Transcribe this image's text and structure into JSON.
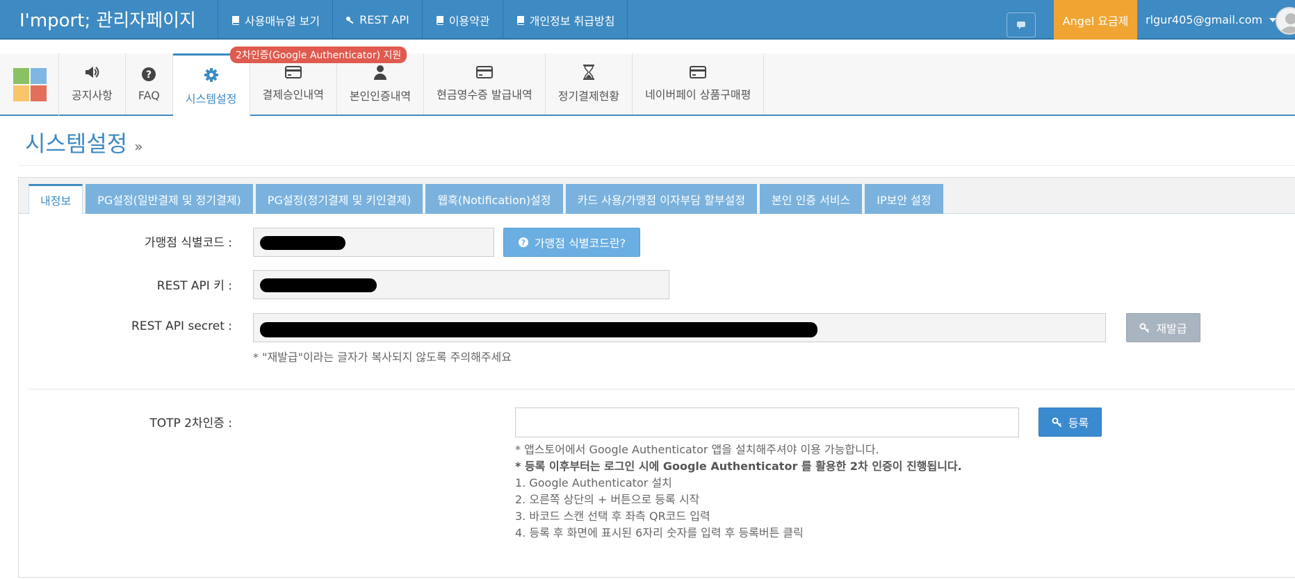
{
  "topbar": {
    "brand": "I'mport; 관리자페이지",
    "nav": [
      {
        "label": "사용매뉴얼 보기",
        "icon": "book-icon"
      },
      {
        "label": "REST API",
        "icon": "key-icon"
      },
      {
        "label": "이용약관",
        "icon": "book-icon"
      },
      {
        "label": "개인정보 취급방침",
        "icon": "book-icon"
      }
    ],
    "plan_label": "Angel 요금제",
    "user_email": "rlgur405@gmail.com"
  },
  "menu": {
    "promo_badge": "2차인증(Google Authenticator) 지원",
    "tabs": [
      {
        "label": "공지사항",
        "icon": "megaphone-icon"
      },
      {
        "label": "FAQ",
        "icon": "question-icon"
      },
      {
        "label": "시스템설정",
        "icon": "gear-icon",
        "active": true
      },
      {
        "label": "결제승인내역",
        "icon": "credit-card-icon"
      },
      {
        "label": "본인인증내역",
        "icon": "user-icon"
      },
      {
        "label": "현금영수증 발급내역",
        "icon": "credit-card-icon"
      },
      {
        "label": "정기결제현황",
        "icon": "hourglass-icon"
      },
      {
        "label": "네이버페이 상품구매평",
        "icon": "credit-card-icon"
      }
    ],
    "logo_colors": [
      "#8bc163",
      "#7fb7e3",
      "#f8c56b",
      "#e36f5a"
    ]
  },
  "page": {
    "title": "시스템설정",
    "raquo": "»"
  },
  "settings": {
    "tabs": [
      {
        "label": "내정보",
        "active": true
      },
      {
        "label": "PG설정(일반결제 및 정기결제)"
      },
      {
        "label": "PG설정(정기결제 및 키인결제)"
      },
      {
        "label": "웹훅(Notification)설정"
      },
      {
        "label": "카드 사용/가맹점 이자부담 할부설정"
      },
      {
        "label": "본인 인증 서비스"
      },
      {
        "label": "IP보안 설정"
      }
    ],
    "merchant_code_label": "가맹점 식별코드 :",
    "merchant_code_help": "가맹점 식별코드란?",
    "rest_key_label": "REST API 키 :",
    "rest_secret_label": "REST API secret :",
    "reissue_label": "재발급",
    "reissue_note": "* \"재발급\"이라는 글자가 복사되지 않도록 주의해주세요",
    "totp_label": "TOTP 2차인증 :",
    "register_label": "등록",
    "instructions": [
      "* 앱스토어에서 Google Authenticator 앱을 설치해주셔야 이용 가능합니다.",
      "* 등록 이후부터는 로그인 시에 Google Authenticator 를 활용한 2차 인증이 진행됩니다.",
      "1. Google Authenticator 설치",
      "2. 오른쪽 상단의 + 버튼으로 등록 시작",
      "3. 바코드 스캔 선택 후 좌측 QR코드 입력",
      "4. 등록 후 화면에 표시된 6자리 숫자를 입력 후 등록버튼 클릭"
    ]
  }
}
